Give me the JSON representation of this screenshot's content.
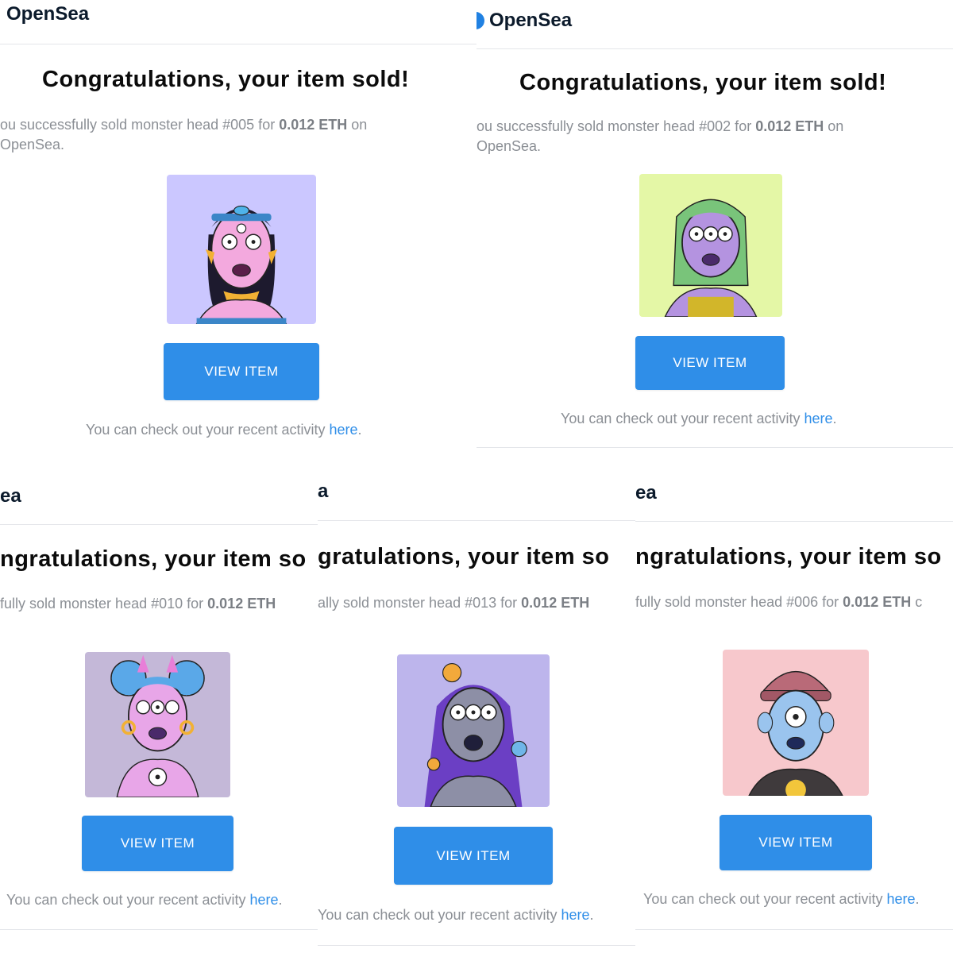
{
  "emails": [
    {
      "logo": "OpenSea",
      "title": "Congratulations, your item sold!",
      "line1_prefix": "ou successfully sold monster head #005 for ",
      "price": "0.012 ETH",
      "line1_suffix": " on",
      "line2": "OpenSea.",
      "button_label": "VIEW ITEM",
      "footer_text": "You can check out your recent activity ",
      "footer_link": "here",
      "footer_end": ".",
      "art": {
        "icon": "monster-head-nft",
        "bg": "#cbc7ff",
        "skin": "#f3a9de"
      }
    },
    {
      "logo": "OpenSea",
      "title": "Congratulations, your item sold!",
      "line1_prefix": "ou successfully sold monster head #002 for ",
      "price": "0.012 ETH",
      "line1_suffix": " on",
      "line2": "OpenSea.",
      "button_label": "VIEW ITEM",
      "footer_text": "You can check out your recent activity ",
      "footer_link": "here",
      "footer_end": ".",
      "art": {
        "icon": "monster-head-nft",
        "bg": "#e4f7a6",
        "skin": "#b493e0",
        "hair": "#79c47a"
      }
    },
    {
      "logo": "ea",
      "title": "ngratulations, your item so",
      "line1_prefix": "fully sold monster head #010 for ",
      "price": "0.012 ETH",
      "line1_suffix": "",
      "button_label": "VIEW ITEM",
      "footer_text": "You can check out your recent activity ",
      "footer_link": "here",
      "footer_end": ".",
      "art": {
        "icon": "monster-head-nft",
        "bg": "#c4b8d8",
        "skin": "#e8a6e8",
        "hair": "#5aa8e8"
      }
    },
    {
      "logo": "a",
      "title": "gratulations, your item so",
      "line1_prefix": "ally sold monster head #013 for ",
      "price": "0.012 ETH",
      "line1_suffix": "",
      "button_label": "VIEW ITEM",
      "footer_text": "You can check out your recent activity ",
      "footer_link": "here",
      "footer_end": ".",
      "art": {
        "icon": "monster-head-nft",
        "bg": "#bdb5ec",
        "skin": "#8d8fa6",
        "hair": "#6b3fc4"
      }
    },
    {
      "logo": "ea",
      "title": "ngratulations, your item so",
      "line1_prefix": "fully sold monster head #006 for ",
      "price": "0.012 ETH",
      "line1_suffix": " c",
      "button_label": "VIEW ITEM",
      "footer_text": "You can check out your recent activity ",
      "footer_link": "here",
      "footer_end": ".",
      "art": {
        "icon": "monster-head-nft",
        "bg": "#f7c8cc",
        "skin": "#9ac4ee",
        "hat": "#b96a78"
      }
    }
  ],
  "colors": {
    "button": "#2f8ee8",
    "link": "#2f8ee8",
    "text_muted": "#8b8f95",
    "logo_blue": "#2081e2"
  }
}
